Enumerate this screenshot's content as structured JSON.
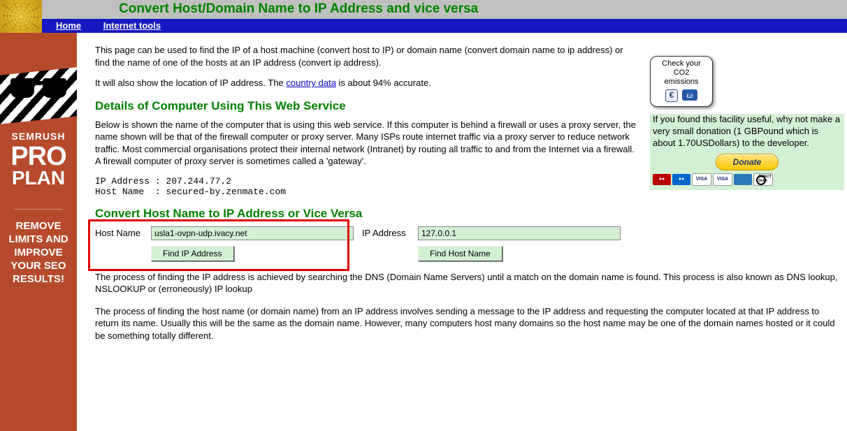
{
  "header": {
    "title": "Convert Host/Domain Name to IP Address and vice versa",
    "nav": {
      "home": "Home",
      "tools": "Internet tools"
    }
  },
  "sidebar": {
    "brand": "SEMRUSH",
    "pro": "PRO",
    "plan": "PLAN",
    "tagline1": "REMOVE",
    "tagline2": "LIMITS AND",
    "tagline3": "IMPROVE",
    "tagline4": "YOUR SEO",
    "tagline5": "RESULTS!"
  },
  "intro": {
    "p1": "This page can be used to find the IP of a host machine (convert host to IP) or domain name (convert domain name to ip address) or find the name of one of the hosts at an IP address (convert ip address).",
    "p2a": "It will also show the location of IP address. The ",
    "country_link": "country data",
    "p2b": " is about 94% accurate."
  },
  "details": {
    "heading": "Details of Computer Using This Web Service",
    "p": "Below is shown the name of the computer that is using this web service. If this computer is behind a firewall or uses a proxy server, the name shown will be that of the firewall computer or proxy server. Many ISPs route internet traffic via a proxy server to reduce network traffic. Most commercial organisations protect their internal network (Intranet) by routing all traffic to and from the Internet via a firewall. A firewall computer of proxy server is sometimes called a 'gateway'.",
    "mono": "IP Address : 207.244.77.2\nHost Name  : secured-by.zenmate.com"
  },
  "convert": {
    "heading": "Convert Host Name to IP Address or Vice Versa",
    "host_label": "Host Name",
    "host_value": "usla1-ovpn-udp.ivacy.net",
    "host_btn": "Find IP Address",
    "ip_label": "IP Address",
    "ip_value": "127.0.0.1",
    "ip_btn": "Find Host Name"
  },
  "explain": {
    "p1": "The process of finding the IP address is achieved by searching the DNS (Domain Name Servers) until a match on the domain name is found. This process is also known as DNS lookup, NSLOOKUP or (erroneously) IP lookup",
    "p2": "The process of finding the host name (or domain name) from an IP address involves sending a message to the IP address and requesting the computer located at that IP address to return its name. Usually this will be the same as the domain name. However, many computers host many domains so the host name may be one of the domain names hosted or it could be something totally different."
  },
  "right": {
    "co2_l1": "Check your",
    "co2_l2": "CO2",
    "co2_l3": "emissions",
    "donate_text": "If you found this facility useful, why not make a very small donation (1 GBPound which is about 1.70USDollars) to the developer.",
    "donate_btn": "Donate"
  }
}
